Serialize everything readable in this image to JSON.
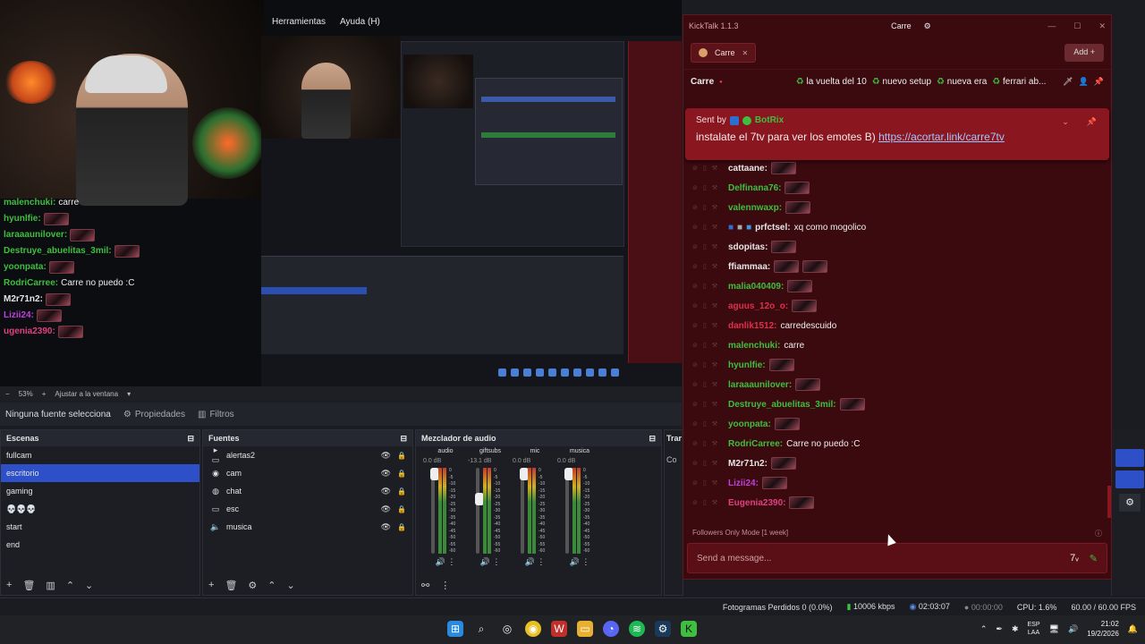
{
  "obs": {
    "menu": [
      "Herramientas",
      "Ayuda (H)"
    ],
    "zoom": "53%",
    "zoom_fit": "Ajustar a la ventana",
    "no_source": "Ninguna fuente selecciona",
    "properties": "Propiedades",
    "filters": "Filtros",
    "scenes_title": "Escenas",
    "scenes": [
      "fullcam",
      "escritorio",
      "gaming",
      "💀💀💀",
      "start",
      "end"
    ],
    "active_scene": "escritorio",
    "sources_title": "Fuentes",
    "sources": [
      {
        "name": "alertas2",
        "icon": "folder-icon"
      },
      {
        "name": "cam",
        "icon": "camera-icon"
      },
      {
        "name": "chat",
        "icon": "browser-icon"
      },
      {
        "name": "esc",
        "icon": "display-icon"
      },
      {
        "name": "musica",
        "icon": "speaker-icon"
      }
    ],
    "mixer_title": "Mezclador de audio",
    "mixer": [
      {
        "name": "audio",
        "db": "0.0 dB"
      },
      {
        "name": "giftsubs",
        "db": "-13.1 dB"
      },
      {
        "name": "mic",
        "db": "0.0 dB"
      },
      {
        "name": "musica",
        "db": "0.0 dB"
      }
    ],
    "mixer_scale": [
      "0",
      "-5",
      "-10",
      "-15",
      "-20",
      "-25",
      "-30",
      "-35",
      "-40",
      "-45",
      "-50",
      "-55",
      "-60"
    ],
    "transitions_title": "Trar",
    "transitions_sub": "Co",
    "status": {
      "dropped": "Fotogramas Perdidos 0 (0.0%)",
      "kbps": "10006 kbps",
      "live_time": "02:03:07",
      "rec_time": "00:00:00",
      "cpu": "CPU: 1.6%",
      "fps": "60.00 / 60.00 FPS"
    }
  },
  "overlay_chat": [
    {
      "user": "malenchuki:",
      "color": "#3fbf3f",
      "text": "carre",
      "emotes": 0
    },
    {
      "user": "hyunlfie:",
      "color": "#3fbf3f",
      "text": "",
      "emotes": 1
    },
    {
      "user": "laraaaunilover:",
      "color": "#3fbf3f",
      "text": "",
      "emotes": 1
    },
    {
      "user": "Destruye_abuelitas_3mil:",
      "color": "#3fbf3f",
      "text": "",
      "emotes": 1
    },
    {
      "user": "yoonpata:",
      "color": "#3fbf3f",
      "text": "",
      "emotes": 1
    },
    {
      "user": "RodriCarree:",
      "color": "#3fbf3f",
      "text": "Carre no puedo :C",
      "emotes": 0
    },
    {
      "user": "M2r71n2:",
      "color": "#e6e6e6",
      "text": "",
      "emotes": 1
    },
    {
      "user": "Lizii24:",
      "color": "#c040e0",
      "text": "",
      "emotes": 1
    },
    {
      "user": "ugenia2390:",
      "color": "#e04080",
      "text": "",
      "emotes": 1
    }
  ],
  "kicktalk": {
    "title": "KickTalk 1.1.3",
    "channel_tab_top": "Carre",
    "tab": "Carre",
    "add": "Add",
    "channel": "Carre",
    "topics": [
      "la vuelta del 10",
      "nuevo setup",
      "nueva era",
      "ferrari ab..."
    ],
    "pinned": {
      "sent_by": "Sent by",
      "bot": "BotRix",
      "text": "instalate el 7tv para ver los emotes B)",
      "link": "https://acortar.link/carre7tv"
    },
    "messages": [
      {
        "user": "cattaane:",
        "color": "#e6e6e6",
        "text": "",
        "emotes": 1,
        "badges": 0
      },
      {
        "user": "Delfinana76:",
        "color": "#3fbf3f",
        "text": "",
        "emotes": 1,
        "badges": 0
      },
      {
        "user": "valennwaxp:",
        "color": "#3fbf3f",
        "text": "",
        "emotes": 1,
        "badges": 0
      },
      {
        "user": "prfctsel:",
        "color": "#e6e6e6",
        "text": "xq como mogolico",
        "emotes": 0,
        "badges": 3
      },
      {
        "user": "sdopitas:",
        "color": "#e6e6e6",
        "text": "",
        "emotes": 1,
        "badges": 0
      },
      {
        "user": "ffiammaa:",
        "color": "#e6e6e6",
        "text": "",
        "emotes": 2,
        "badges": 0
      },
      {
        "user": "malia040409:",
        "color": "#3fbf3f",
        "text": "",
        "emotes": 1,
        "badges": 0
      },
      {
        "user": "aguus_12o_o:",
        "color": "#e0304a",
        "text": "",
        "emotes": 1,
        "badges": 0
      },
      {
        "user": "danlik1512:",
        "color": "#e0304a",
        "text": "carredescuido",
        "emotes": 0,
        "badges": 0
      },
      {
        "user": "malenchuki:",
        "color": "#3fbf3f",
        "text": "carre",
        "emotes": 0,
        "badges": 0
      },
      {
        "user": "hyunlfie:",
        "color": "#3fbf3f",
        "text": "",
        "emotes": 1,
        "badges": 0
      },
      {
        "user": "laraaaunilover:",
        "color": "#3fbf3f",
        "text": "",
        "emotes": 1,
        "badges": 0
      },
      {
        "user": "Destruye_abuelitas_3mil:",
        "color": "#3fbf3f",
        "text": "",
        "emotes": 1,
        "badges": 0
      },
      {
        "user": "yoonpata:",
        "color": "#3fbf3f",
        "text": "",
        "emotes": 1,
        "badges": 0
      },
      {
        "user": "RodriCarree:",
        "color": "#3fbf3f",
        "text": "Carre no puedo :C",
        "emotes": 0,
        "badges": 0
      },
      {
        "user": "M2r71n2:",
        "color": "#e6e6e6",
        "text": "",
        "emotes": 1,
        "badges": 0
      },
      {
        "user": "Lizii24:",
        "color": "#c040e0",
        "text": "",
        "emotes": 1,
        "badges": 0
      },
      {
        "user": "Eugenia2390:",
        "color": "#e04080",
        "text": "",
        "emotes": 1,
        "badges": 0
      }
    ],
    "followers_mode": "Followers Only Mode [1 week]",
    "input_placeholder": "Send a message..."
  },
  "taskbar": {
    "lang": "ESP",
    "lang2": "LAA",
    "time": "21:02",
    "date": "19/2/2026"
  },
  "colors": {
    "kick_bg": "#3a0a0f",
    "pinned_bg": "#8a1620",
    "obs_accent": "#2d4fc7"
  }
}
